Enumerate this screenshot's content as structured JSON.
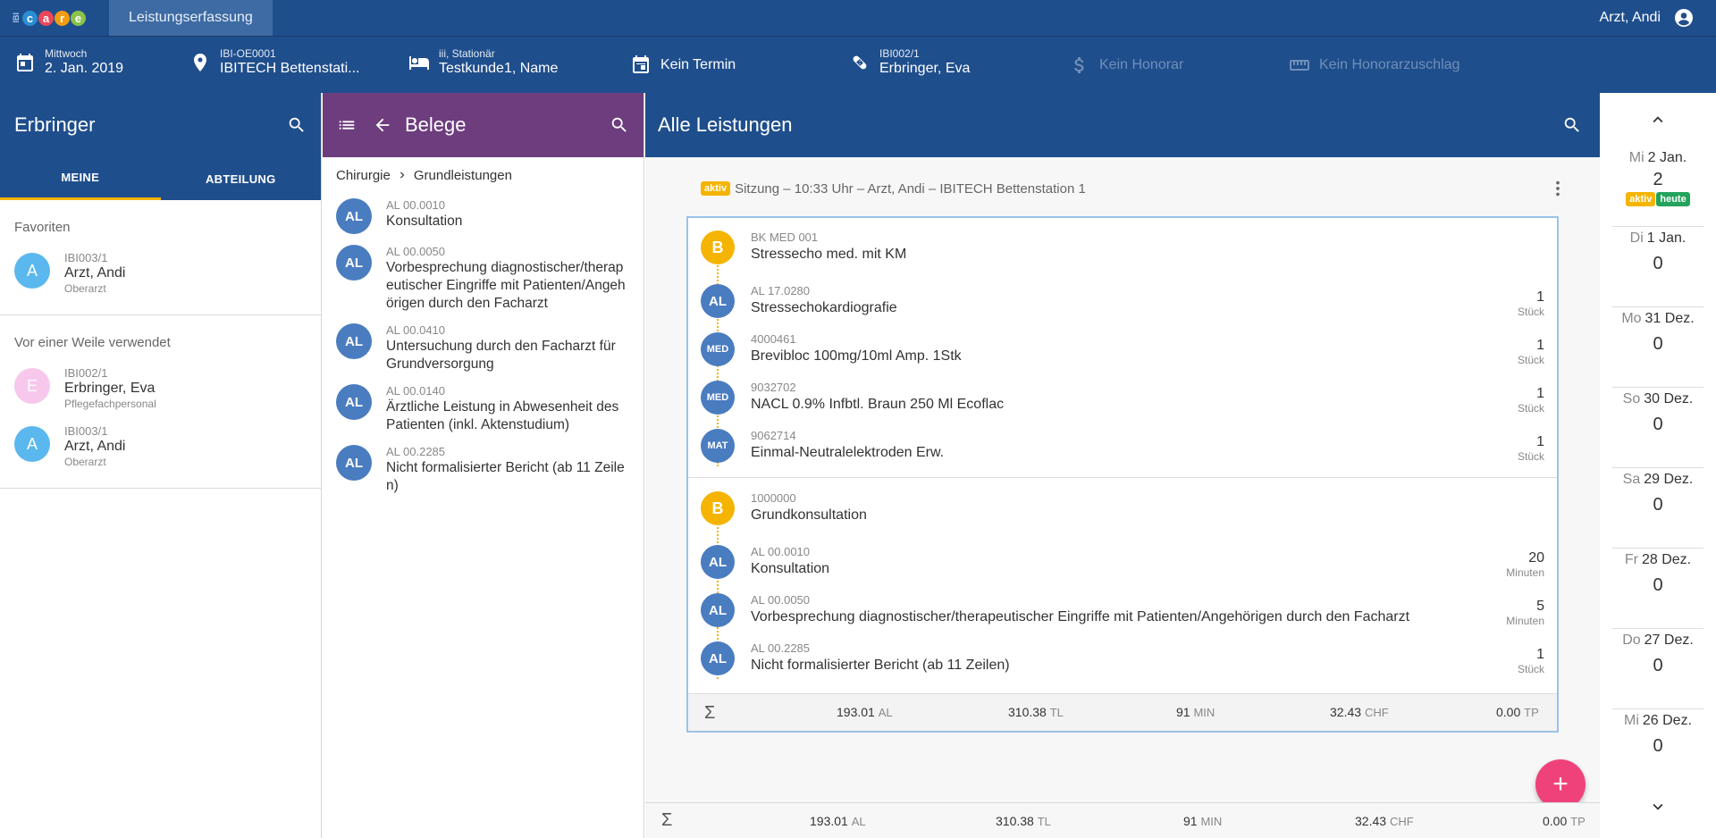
{
  "app": {
    "logo_small": "IBI",
    "logo_letters": [
      "c",
      "a",
      "r",
      "e"
    ],
    "tab_label": "Leistungserfassung",
    "user_name": "Arzt, Andi"
  },
  "colors": {
    "primary": "#1f4e8c",
    "belege_header": "#6d3d7e",
    "accent_yellow": "#f5b400",
    "fab_pink": "#f0427a",
    "avatar_blue": "#4a7cc0",
    "logo_colors": [
      "#2a8dd4",
      "#e9475a",
      "#f39c12",
      "#8bc34a"
    ]
  },
  "context": {
    "date": {
      "small": "Mittwoch",
      "big": "2. Jan. 2019",
      "icon": "calendar-icon"
    },
    "location": {
      "small": "IBI-OE0001",
      "big": "IBITECH Bettenstati...",
      "icon": "location-pin-icon"
    },
    "patient": {
      "small": "iii, Stationär",
      "big": "Testkunde1, Name",
      "icon": "bed-icon"
    },
    "termin": {
      "big": "Kein Termin",
      "icon": "calendar-note-icon"
    },
    "erbringer": {
      "small": "IBI002/1",
      "big": "Erbringer, Eva",
      "icon": "bandage-icon"
    },
    "honorar": {
      "big": "Kein Honorar",
      "icon": "dollar-icon"
    },
    "zuschlag": {
      "big": "Kein Honorarzuschlag",
      "icon": "ruler-icon"
    }
  },
  "erbringer_panel": {
    "title": "Erbringer",
    "tabs": [
      "MEINE",
      "ABTEILUNG"
    ],
    "favorites_label": "Favoriten",
    "favorites": [
      {
        "initial": "A",
        "id": "IBI003/1",
        "name": "Arzt, Andi",
        "role": "Oberarzt",
        "color": "#5bb8ee"
      }
    ],
    "recent_label": "Vor einer Weile verwendet",
    "recent": [
      {
        "initial": "E",
        "id": "IBI002/1",
        "name": "Erbringer, Eva",
        "role": "Pflegefachpersonal",
        "color": "#f7c7ec"
      },
      {
        "initial": "A",
        "id": "IBI003/1",
        "name": "Arzt, Andi",
        "role": "Oberarzt",
        "color": "#5bb8ee"
      }
    ]
  },
  "belege_panel": {
    "title": "Belege",
    "breadcrumb": [
      "Chirurgie",
      "Grundleistungen"
    ],
    "items": [
      {
        "avatar": "AL",
        "code": "AL 00.0010",
        "name": "Konsultation"
      },
      {
        "avatar": "AL",
        "code": "AL 00.0050",
        "name": "Vorbesprechung diagnostischer/therapeutischer Eingriffe mit Patienten/Angehörigen durch den Facharzt"
      },
      {
        "avatar": "AL",
        "code": "AL 00.0410",
        "name": "Untersuchung durch den Facharzt für Grundversorgung"
      },
      {
        "avatar": "AL",
        "code": "AL 00.0140",
        "name": "Ärztliche Leistung in Abwesenheit des Patienten (inkl. Aktenstudium)"
      },
      {
        "avatar": "AL",
        "code": "AL 00.2285",
        "name": "Nicht formalisierter Bericht (ab 11 Zeilen)"
      }
    ]
  },
  "leistungen_panel": {
    "title": "Alle Leistungen",
    "session": {
      "badge": "aktiv",
      "text": "Sitzung – 10:33 Uhr – Arzt, Andi – IBITECH Bettenstation 1"
    },
    "groups": [
      {
        "header": {
          "avatar": "B",
          "code": "BK MED 001",
          "name": "Stressecho med. mit KM"
        },
        "rows": [
          {
            "avatar": "AL",
            "code": "AL 17.0280",
            "name": "Stressechokardiografie",
            "qty": "1",
            "unit": "Stück"
          },
          {
            "avatar": "MED",
            "code": "4000461",
            "name": "Brevibloc 100mg/10ml Amp. 1Stk",
            "qty": "1",
            "unit": "Stück"
          },
          {
            "avatar": "MED",
            "code": "9032702",
            "name": "NACL 0.9% Infbtl. Braun 250 Ml Ecoflac",
            "qty": "1",
            "unit": "Stück"
          },
          {
            "avatar": "MAT",
            "code": "9062714",
            "name": "Einmal-Neutralelektroden Erw.",
            "qty": "1",
            "unit": "Stück"
          }
        ]
      },
      {
        "header": {
          "avatar": "B",
          "code": "1000000",
          "name": "Grundkonsultation"
        },
        "rows": [
          {
            "avatar": "AL",
            "code": "AL 00.0010",
            "name": "Konsultation",
            "qty": "20",
            "unit": "Minuten"
          },
          {
            "avatar": "AL",
            "code": "AL 00.0050",
            "name": "Vorbesprechung diagnostischer/therapeutischer Eingriffe mit Patienten/Angehörigen durch den Facharzt",
            "qty": "5",
            "unit": "Minuten"
          },
          {
            "avatar": "AL",
            "code": "AL 00.2285",
            "name": "Nicht formalisierter Bericht (ab 11 Zeilen)",
            "qty": "1",
            "unit": "Stück"
          }
        ]
      }
    ],
    "card_sum": [
      {
        "value": "193.01",
        "unit": "AL"
      },
      {
        "value": "310.38",
        "unit": "TL"
      },
      {
        "value": "91",
        "unit": "MIN"
      },
      {
        "value": "32.43",
        "unit": "CHF"
      },
      {
        "value": "0.00",
        "unit": "TP"
      }
    ],
    "total_sum": [
      {
        "value": "193.01",
        "unit": "AL"
      },
      {
        "value": "310.38",
        "unit": "TL"
      },
      {
        "value": "91",
        "unit": "MIN"
      },
      {
        "value": "32.43",
        "unit": "CHF"
      },
      {
        "value": "0.00",
        "unit": "TP"
      }
    ],
    "sigma": "Σ",
    "fab_label": "+"
  },
  "calendar": {
    "days": [
      {
        "weekday": "Mi",
        "date": "2 Jan.",
        "count": "2",
        "badges": [
          "aktiv",
          "heute"
        ]
      },
      {
        "weekday": "Di",
        "date": "1 Jan.",
        "count": "0",
        "badges": []
      },
      {
        "weekday": "Mo",
        "date": "31 Dez.",
        "count": "0",
        "badges": []
      },
      {
        "weekday": "So",
        "date": "30 Dez.",
        "count": "0",
        "badges": []
      },
      {
        "weekday": "Sa",
        "date": "29 Dez.",
        "count": "0",
        "badges": []
      },
      {
        "weekday": "Fr",
        "date": "28 Dez.",
        "count": "0",
        "badges": []
      },
      {
        "weekday": "Do",
        "date": "27 Dez.",
        "count": "0",
        "badges": []
      },
      {
        "weekday": "Mi",
        "date": "26 Dez.",
        "count": "0",
        "badges": []
      }
    ]
  }
}
